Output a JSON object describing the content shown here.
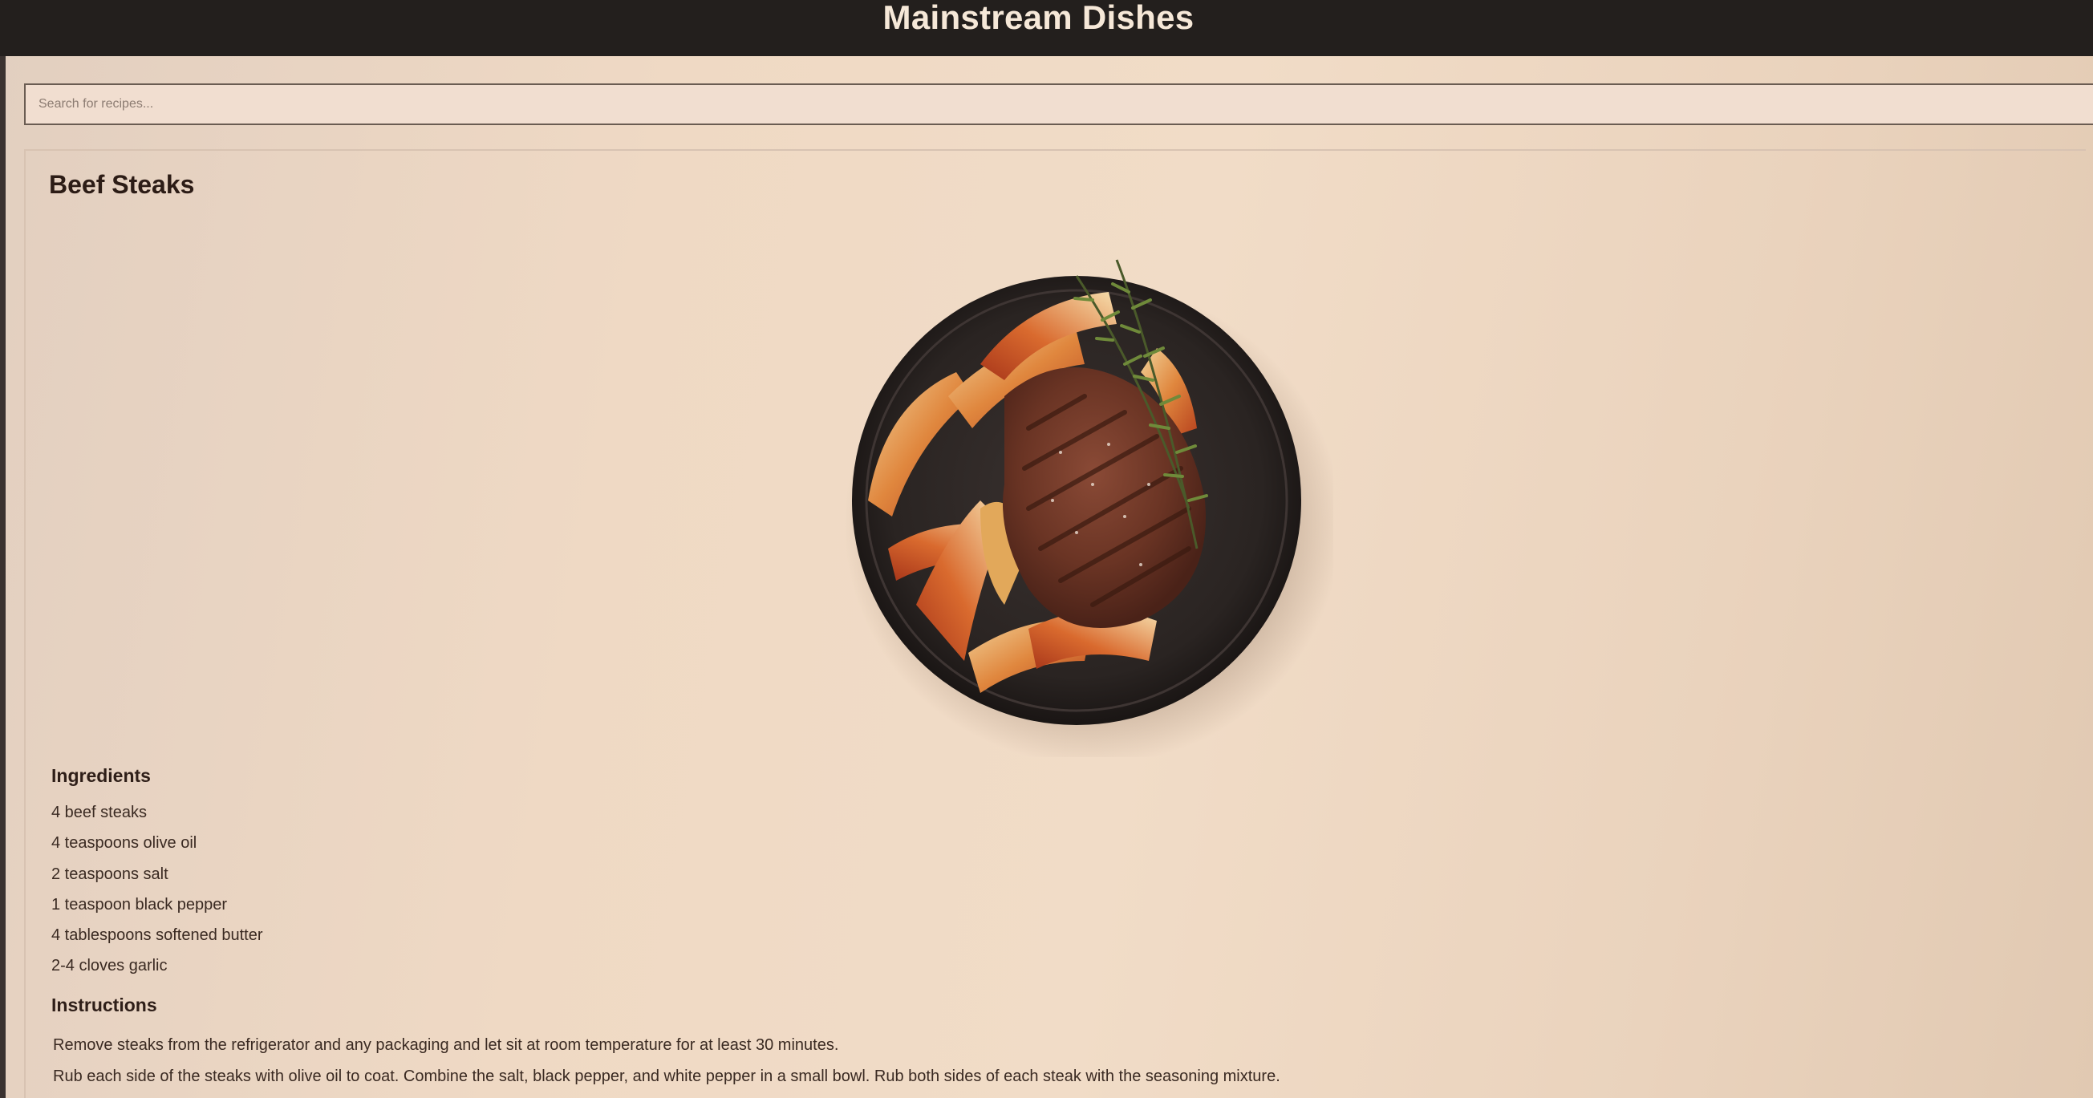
{
  "header": {
    "title": "Mainstream Dishes"
  },
  "search": {
    "placeholder": "Search for recipes..."
  },
  "recipe": {
    "title": "Beef Steaks",
    "image_alt": "Grilled beef steak with potato wedges and rosemary on a dark plate",
    "ingredients_heading": "Ingredients",
    "ingredients": [
      "4 beef steaks",
      "4 teaspoons olive oil",
      "2 teaspoons salt",
      "1 teaspoon black pepper",
      "4 tablespoons softened butter",
      "2-4 cloves garlic"
    ],
    "instructions_heading": "Instructions",
    "instructions": [
      "Remove steaks from the refrigerator and any packaging and let sit at room temperature for at least 30 minutes.",
      "Rub each side of the steaks with olive oil to coat. Combine the salt, black pepper, and white pepper in a small bowl. Rub both sides of each steak with the seasoning mixture."
    ]
  },
  "colors": {
    "header_bg": "#231f1d",
    "header_text": "#f6e8d8",
    "page_bg": "#f1dcc7",
    "text": "#3a2a22"
  }
}
